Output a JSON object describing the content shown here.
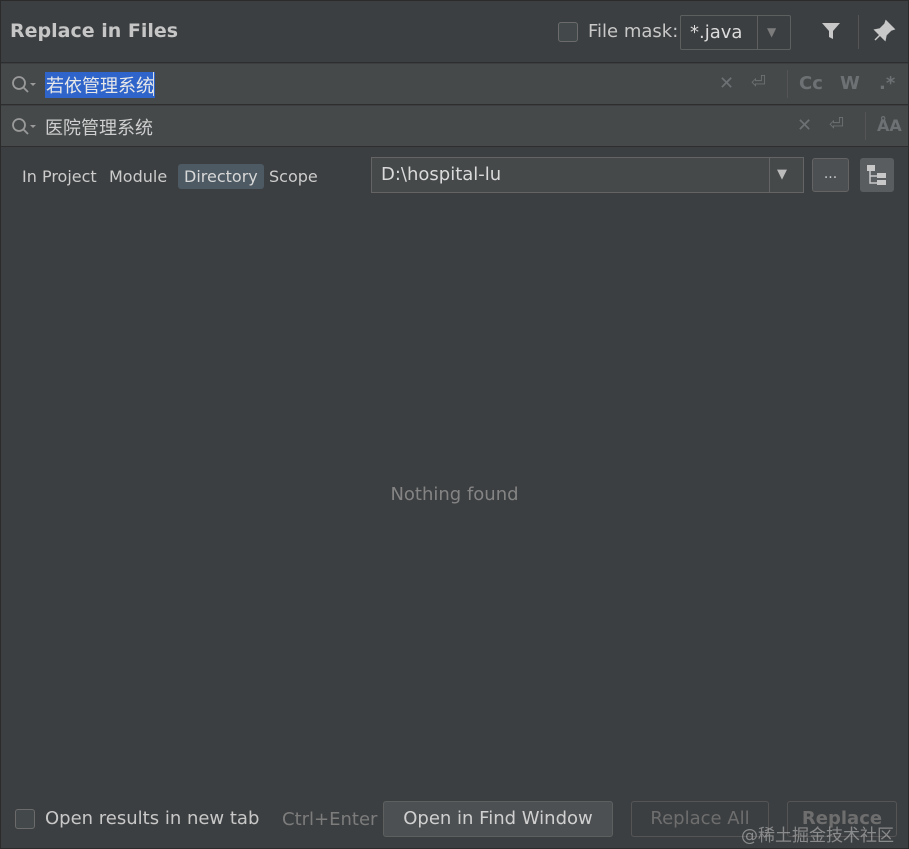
{
  "window": {
    "title": "Replace in Files"
  },
  "file_mask": {
    "label": "File mask:",
    "checked": false,
    "value": "*.java"
  },
  "search": {
    "find_text": "若依管理系统",
    "replace_text": "医院管理系统"
  },
  "find_options": {
    "match_case": "Cc",
    "words": "W",
    "regex": ".*"
  },
  "scope": {
    "tabs": [
      {
        "label": "In Project"
      },
      {
        "label": "Module"
      },
      {
        "label": "Directory",
        "active": true
      },
      {
        "label": "Scope"
      }
    ],
    "directory": "D:\\hospital-lu",
    "browse_label": "..."
  },
  "results": {
    "empty_message": "Nothing found"
  },
  "footer": {
    "new_tab_label": "Open results in new tab",
    "new_tab_checked": false,
    "shortcut": "Ctrl+Enter",
    "open_find_window": "Open in Find Window",
    "replace_all": "Replace All",
    "replace": "Replace"
  },
  "watermark": "@稀土掘金技术社区",
  "colors": {
    "background": "#3c3f41",
    "selection": "#2f65ca",
    "active_tab": "#4d5a63"
  }
}
